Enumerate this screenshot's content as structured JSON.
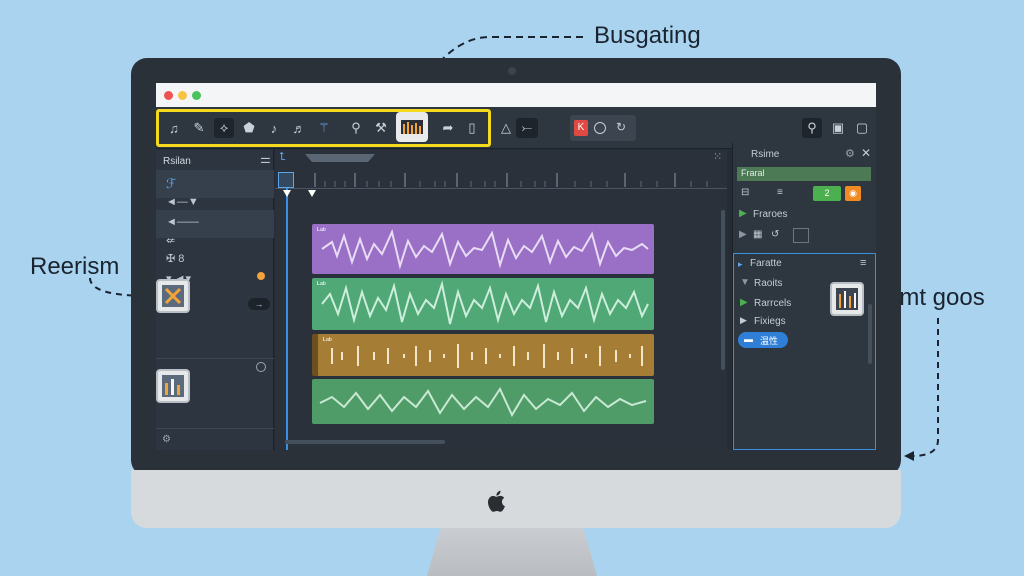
{
  "callouts": {
    "top": "Busgating",
    "left": "Reerism",
    "right": "Rmt goos"
  },
  "left_panel": {
    "title": "Rsilan",
    "rows": [
      "ℱ",
      "◄—▼",
      "◄——",
      "⇍",
      "✠ 8",
      "▾ ◄▾"
    ]
  },
  "right_panel": {
    "header": "Rsime",
    "field_value": "Fraral",
    "item_frames": "Fraroes",
    "section": "Faratte",
    "items": [
      "Raoits",
      "Rarrcels",
      "Fixiegs"
    ],
    "tag": "温性"
  },
  "track_labels": [
    "ᴸᵃᵇ",
    "ᴸᵃᵇ",
    "ᴸᵃᵇ"
  ],
  "colors": {
    "track_purple": "#9a6fc6",
    "track_green": "#4fa876",
    "track_gold": "#a57d35",
    "track_green2": "#4f9c68",
    "highlight": "#f4d91c",
    "accent_blue": "#2f7fd7"
  }
}
